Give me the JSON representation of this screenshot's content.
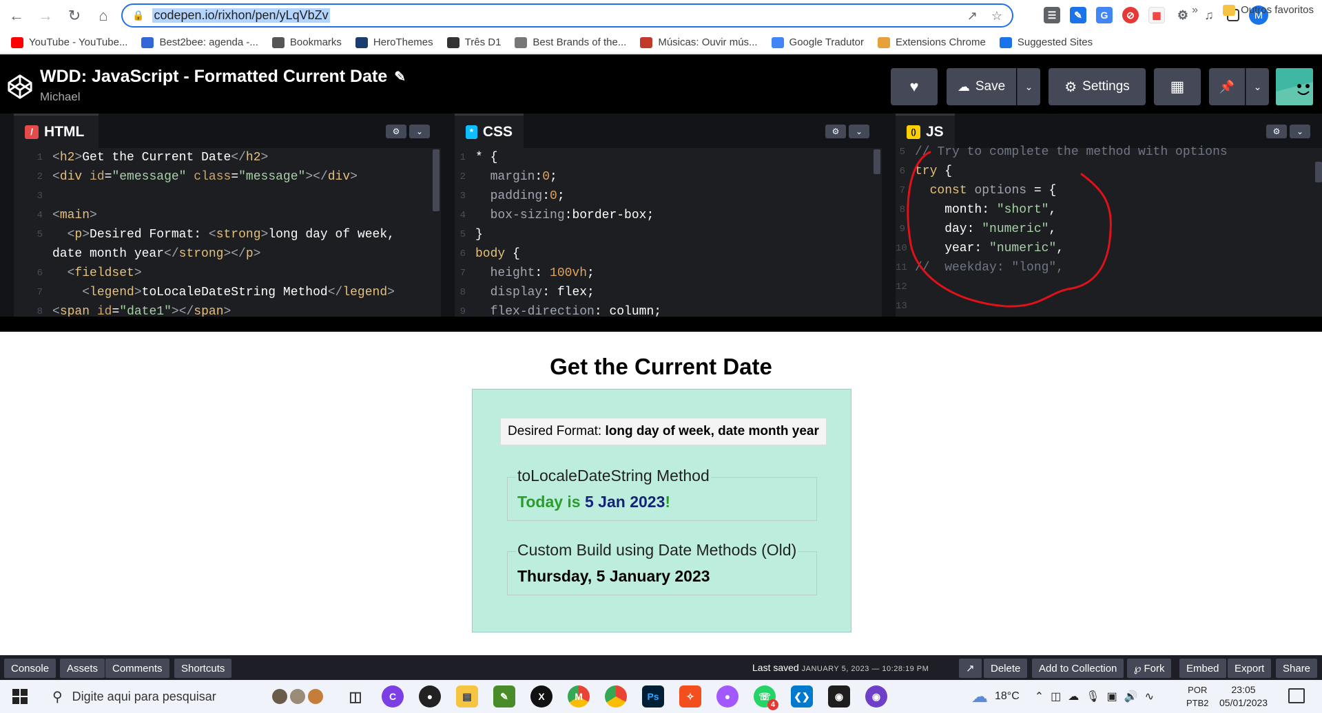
{
  "browser": {
    "url": "codepen.io/rixhon/pen/yLqVbZv",
    "profile_initial": "M",
    "bookmarks": [
      {
        "label": "YouTube - YouTube...",
        "color": "#ff0000"
      },
      {
        "label": "Best2bee: agenda -...",
        "color": "#3367d6"
      },
      {
        "label": "Bookmarks",
        "color": "#555"
      },
      {
        "label": "HeroThemes",
        "color": "#1a3c6e"
      },
      {
        "label": "Três D1",
        "color": "#333"
      },
      {
        "label": "Best Brands of the...",
        "color": "#777"
      },
      {
        "label": "Músicas: Ouvir mús...",
        "color": "#c0392b"
      },
      {
        "label": "Google Tradutor",
        "color": "#4285f4"
      },
      {
        "label": "Extensions Chrome",
        "color": "#e8a13a"
      },
      {
        "label": "Suggested Sites",
        "color": "#1a73e8"
      }
    ],
    "bookmarks_more": "»",
    "other_favorites": "Outros favoritos"
  },
  "codepen": {
    "title": "WDD: JavaScript - Formatted Current Date",
    "user": "Michael",
    "buttons": {
      "save": "Save",
      "settings": "Settings"
    },
    "panes": [
      {
        "name": "HTML",
        "color": "#e44c4c",
        "glyph": "/"
      },
      {
        "name": "CSS",
        "color": "#0ebeff",
        "glyph": "*"
      },
      {
        "name": "JS",
        "color": "#fcd000",
        "glyph": "()"
      }
    ],
    "footer": {
      "console": "Console",
      "assets": "Assets",
      "comments": "Comments",
      "shortcuts": "Shortcuts",
      "last_saved_label": "Last saved",
      "last_saved_time": "JANUARY 5, 2023 — 10:28:19 PM",
      "delete": "Delete",
      "add_to_collection": "Add to Collection",
      "fork": "Fork",
      "embed": "Embed",
      "export": "Export",
      "share": "Share"
    }
  },
  "preview": {
    "heading": "Get the Current Date",
    "desired_label": "Desired Format:",
    "desired_value": "long day of week, date month year",
    "fieldset1_legend": "toLocaleDateString Method",
    "fieldset1_prefix": "Today is ",
    "fieldset1_date": "5 Jan 2023",
    "fieldset1_suffix": "!",
    "fieldset2_legend": "Custom Build using Date Methods (Old)",
    "fieldset2_value": "Thursday, 5 January 2023"
  },
  "taskbar": {
    "search_placeholder": "Digite aqui para pesquisar",
    "weather": "18°C",
    "lang_top": "POR",
    "lang_bottom": "PTB2",
    "time": "23:05",
    "date": "05/01/2023",
    "badge_count": "4"
  }
}
